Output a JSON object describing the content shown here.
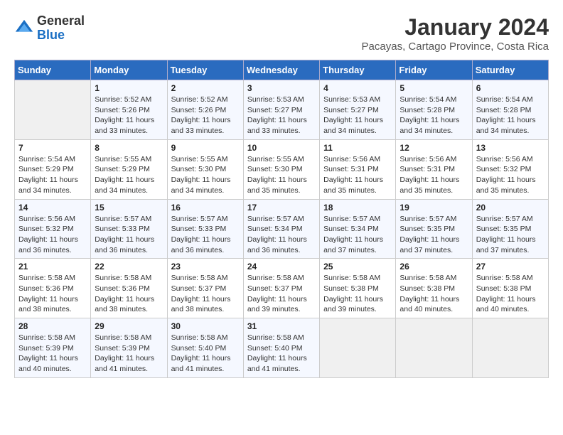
{
  "header": {
    "logo_line1": "General",
    "logo_line2": "Blue",
    "title": "January 2024",
    "subtitle": "Pacayas, Cartago Province, Costa Rica"
  },
  "calendar": {
    "days_of_week": [
      "Sunday",
      "Monday",
      "Tuesday",
      "Wednesday",
      "Thursday",
      "Friday",
      "Saturday"
    ],
    "weeks": [
      [
        {
          "day": "",
          "sunrise": "",
          "sunset": "",
          "daylight": ""
        },
        {
          "day": "1",
          "sunrise": "Sunrise: 5:52 AM",
          "sunset": "Sunset: 5:26 PM",
          "daylight": "Daylight: 11 hours and 33 minutes."
        },
        {
          "day": "2",
          "sunrise": "Sunrise: 5:52 AM",
          "sunset": "Sunset: 5:26 PM",
          "daylight": "Daylight: 11 hours and 33 minutes."
        },
        {
          "day": "3",
          "sunrise": "Sunrise: 5:53 AM",
          "sunset": "Sunset: 5:27 PM",
          "daylight": "Daylight: 11 hours and 33 minutes."
        },
        {
          "day": "4",
          "sunrise": "Sunrise: 5:53 AM",
          "sunset": "Sunset: 5:27 PM",
          "daylight": "Daylight: 11 hours and 34 minutes."
        },
        {
          "day": "5",
          "sunrise": "Sunrise: 5:54 AM",
          "sunset": "Sunset: 5:28 PM",
          "daylight": "Daylight: 11 hours and 34 minutes."
        },
        {
          "day": "6",
          "sunrise": "Sunrise: 5:54 AM",
          "sunset": "Sunset: 5:28 PM",
          "daylight": "Daylight: 11 hours and 34 minutes."
        }
      ],
      [
        {
          "day": "7",
          "sunrise": "Sunrise: 5:54 AM",
          "sunset": "Sunset: 5:29 PM",
          "daylight": "Daylight: 11 hours and 34 minutes."
        },
        {
          "day": "8",
          "sunrise": "Sunrise: 5:55 AM",
          "sunset": "Sunset: 5:29 PM",
          "daylight": "Daylight: 11 hours and 34 minutes."
        },
        {
          "day": "9",
          "sunrise": "Sunrise: 5:55 AM",
          "sunset": "Sunset: 5:30 PM",
          "daylight": "Daylight: 11 hours and 34 minutes."
        },
        {
          "day": "10",
          "sunrise": "Sunrise: 5:55 AM",
          "sunset": "Sunset: 5:30 PM",
          "daylight": "Daylight: 11 hours and 35 minutes."
        },
        {
          "day": "11",
          "sunrise": "Sunrise: 5:56 AM",
          "sunset": "Sunset: 5:31 PM",
          "daylight": "Daylight: 11 hours and 35 minutes."
        },
        {
          "day": "12",
          "sunrise": "Sunrise: 5:56 AM",
          "sunset": "Sunset: 5:31 PM",
          "daylight": "Daylight: 11 hours and 35 minutes."
        },
        {
          "day": "13",
          "sunrise": "Sunrise: 5:56 AM",
          "sunset": "Sunset: 5:32 PM",
          "daylight": "Daylight: 11 hours and 35 minutes."
        }
      ],
      [
        {
          "day": "14",
          "sunrise": "Sunrise: 5:56 AM",
          "sunset": "Sunset: 5:32 PM",
          "daylight": "Daylight: 11 hours and 36 minutes."
        },
        {
          "day": "15",
          "sunrise": "Sunrise: 5:57 AM",
          "sunset": "Sunset: 5:33 PM",
          "daylight": "Daylight: 11 hours and 36 minutes."
        },
        {
          "day": "16",
          "sunrise": "Sunrise: 5:57 AM",
          "sunset": "Sunset: 5:33 PM",
          "daylight": "Daylight: 11 hours and 36 minutes."
        },
        {
          "day": "17",
          "sunrise": "Sunrise: 5:57 AM",
          "sunset": "Sunset: 5:34 PM",
          "daylight": "Daylight: 11 hours and 36 minutes."
        },
        {
          "day": "18",
          "sunrise": "Sunrise: 5:57 AM",
          "sunset": "Sunset: 5:34 PM",
          "daylight": "Daylight: 11 hours and 37 minutes."
        },
        {
          "day": "19",
          "sunrise": "Sunrise: 5:57 AM",
          "sunset": "Sunset: 5:35 PM",
          "daylight": "Daylight: 11 hours and 37 minutes."
        },
        {
          "day": "20",
          "sunrise": "Sunrise: 5:57 AM",
          "sunset": "Sunset: 5:35 PM",
          "daylight": "Daylight: 11 hours and 37 minutes."
        }
      ],
      [
        {
          "day": "21",
          "sunrise": "Sunrise: 5:58 AM",
          "sunset": "Sunset: 5:36 PM",
          "daylight": "Daylight: 11 hours and 38 minutes."
        },
        {
          "day": "22",
          "sunrise": "Sunrise: 5:58 AM",
          "sunset": "Sunset: 5:36 PM",
          "daylight": "Daylight: 11 hours and 38 minutes."
        },
        {
          "day": "23",
          "sunrise": "Sunrise: 5:58 AM",
          "sunset": "Sunset: 5:37 PM",
          "daylight": "Daylight: 11 hours and 38 minutes."
        },
        {
          "day": "24",
          "sunrise": "Sunrise: 5:58 AM",
          "sunset": "Sunset: 5:37 PM",
          "daylight": "Daylight: 11 hours and 39 minutes."
        },
        {
          "day": "25",
          "sunrise": "Sunrise: 5:58 AM",
          "sunset": "Sunset: 5:38 PM",
          "daylight": "Daylight: 11 hours and 39 minutes."
        },
        {
          "day": "26",
          "sunrise": "Sunrise: 5:58 AM",
          "sunset": "Sunset: 5:38 PM",
          "daylight": "Daylight: 11 hours and 40 minutes."
        },
        {
          "day": "27",
          "sunrise": "Sunrise: 5:58 AM",
          "sunset": "Sunset: 5:38 PM",
          "daylight": "Daylight: 11 hours and 40 minutes."
        }
      ],
      [
        {
          "day": "28",
          "sunrise": "Sunrise: 5:58 AM",
          "sunset": "Sunset: 5:39 PM",
          "daylight": "Daylight: 11 hours and 40 minutes."
        },
        {
          "day": "29",
          "sunrise": "Sunrise: 5:58 AM",
          "sunset": "Sunset: 5:39 PM",
          "daylight": "Daylight: 11 hours and 41 minutes."
        },
        {
          "day": "30",
          "sunrise": "Sunrise: 5:58 AM",
          "sunset": "Sunset: 5:40 PM",
          "daylight": "Daylight: 11 hours and 41 minutes."
        },
        {
          "day": "31",
          "sunrise": "Sunrise: 5:58 AM",
          "sunset": "Sunset: 5:40 PM",
          "daylight": "Daylight: 11 hours and 41 minutes."
        },
        {
          "day": "",
          "sunrise": "",
          "sunset": "",
          "daylight": ""
        },
        {
          "day": "",
          "sunrise": "",
          "sunset": "",
          "daylight": ""
        },
        {
          "day": "",
          "sunrise": "",
          "sunset": "",
          "daylight": ""
        }
      ]
    ]
  }
}
